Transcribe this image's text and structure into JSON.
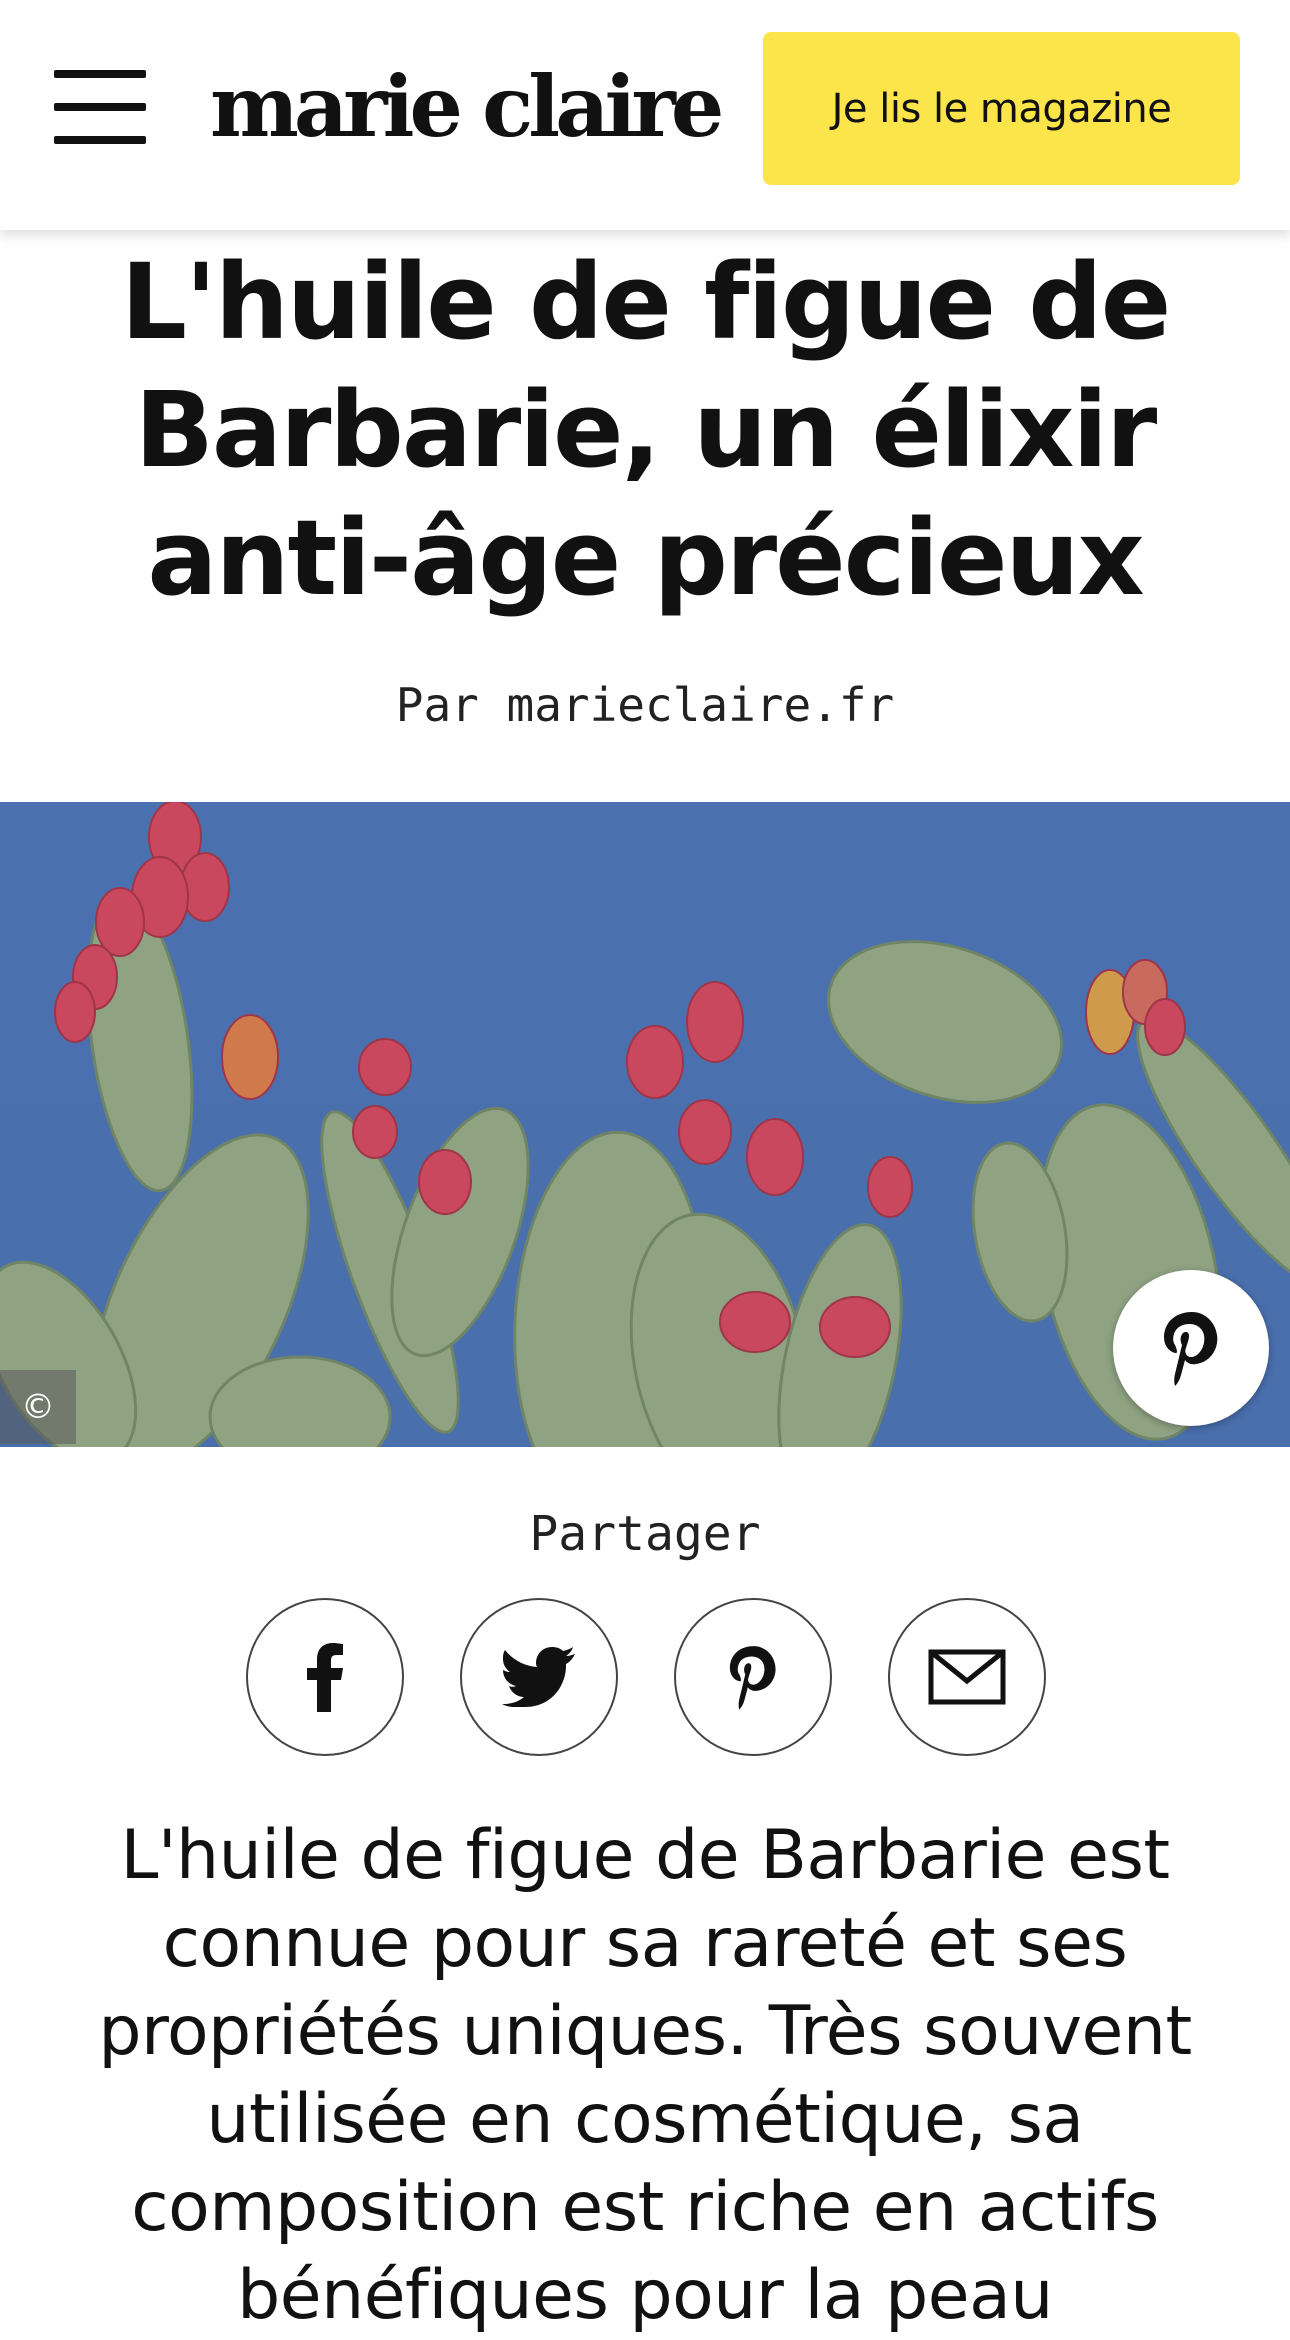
{
  "header": {
    "logo_text": "marie claire",
    "magazine_button": "Je lis le magazine",
    "accent_color": "#fbe54b"
  },
  "article": {
    "title": "L'huile de figue de Barbarie, un élixir anti-âge précieux",
    "byline": "Par marieclaire.fr",
    "hero": {
      "copyright_symbol": "©"
    },
    "share": {
      "label": "Partager",
      "buttons": [
        "facebook-icon",
        "twitter-icon",
        "pinterest-icon",
        "email-icon"
      ]
    },
    "intro": "L'huile de figue de Barbarie est connue pour sa rareté et ses propriétés uniques. Très souvent utilisée en cosmétique, sa composition est riche en actifs bénéfiques pour la peau"
  }
}
